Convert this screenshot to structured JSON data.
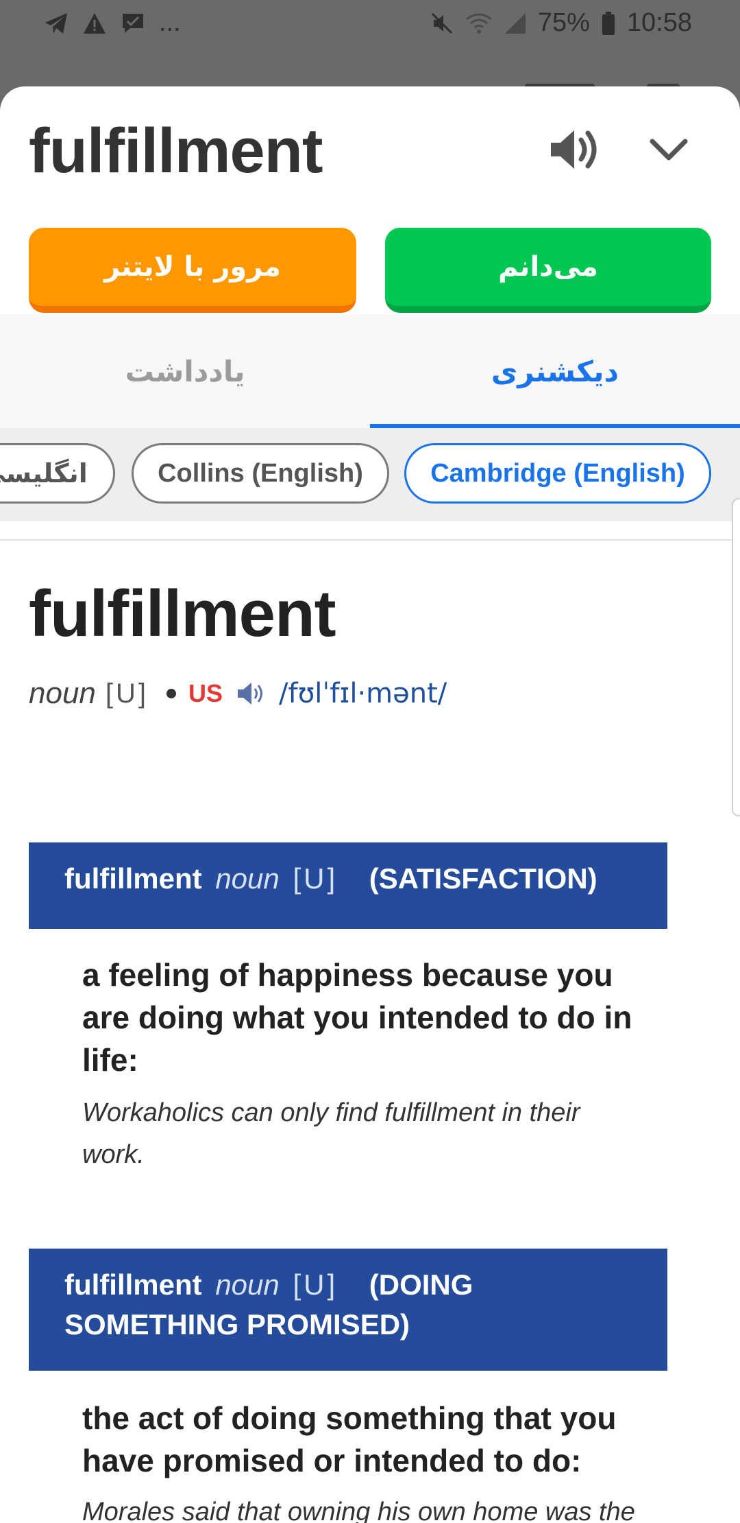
{
  "status_bar": {
    "overflow": "...",
    "battery": "75%",
    "time": "10:58",
    "icons_left": [
      "telegram-icon",
      "warning-icon",
      "message-icon"
    ],
    "icons_right": [
      "mute-icon",
      "wifi-icon",
      "signal-icon",
      "battery-icon"
    ]
  },
  "header": {
    "word": "fulfillment"
  },
  "actions": {
    "review_label": "مرور با لایتنر",
    "know_label": "می‌دانم"
  },
  "tabs": {
    "notes": "یادداشت",
    "dictionary": "دیکشنری"
  },
  "sources": {
    "persian": "انگلیسی",
    "collins": "Collins (English)",
    "cambridge": "Cambridge (English)"
  },
  "entry": {
    "headword": "fulfillment",
    "pos": "noun",
    "grammar": "[U]",
    "region": "US",
    "pronunciation": "/fʊlˈfɪl·mənt/"
  },
  "senses": [
    {
      "word": "fulfillment",
      "pos": "noun",
      "grammar": "[U]",
      "guideword": "(SATISFACTION)",
      "definition": "a feeling of happiness because you are doing what you intended to do in life:",
      "example": "Workaholics can only find fulfillment in their work."
    },
    {
      "word": "fulfillment",
      "pos": "noun",
      "grammar": "[U]",
      "guideword": "(DOING SOMETHING PROMISED)",
      "definition": "the act of doing something that you have promised or intended to do:",
      "example": "Morales said that owning his own home was the fulfillment of a dream."
    }
  ],
  "colors": {
    "orange": "#ff9800",
    "green": "#00c853",
    "blue_accent": "#1a73e8",
    "sense_header": "#244c9a",
    "region_red": "#e53935"
  }
}
